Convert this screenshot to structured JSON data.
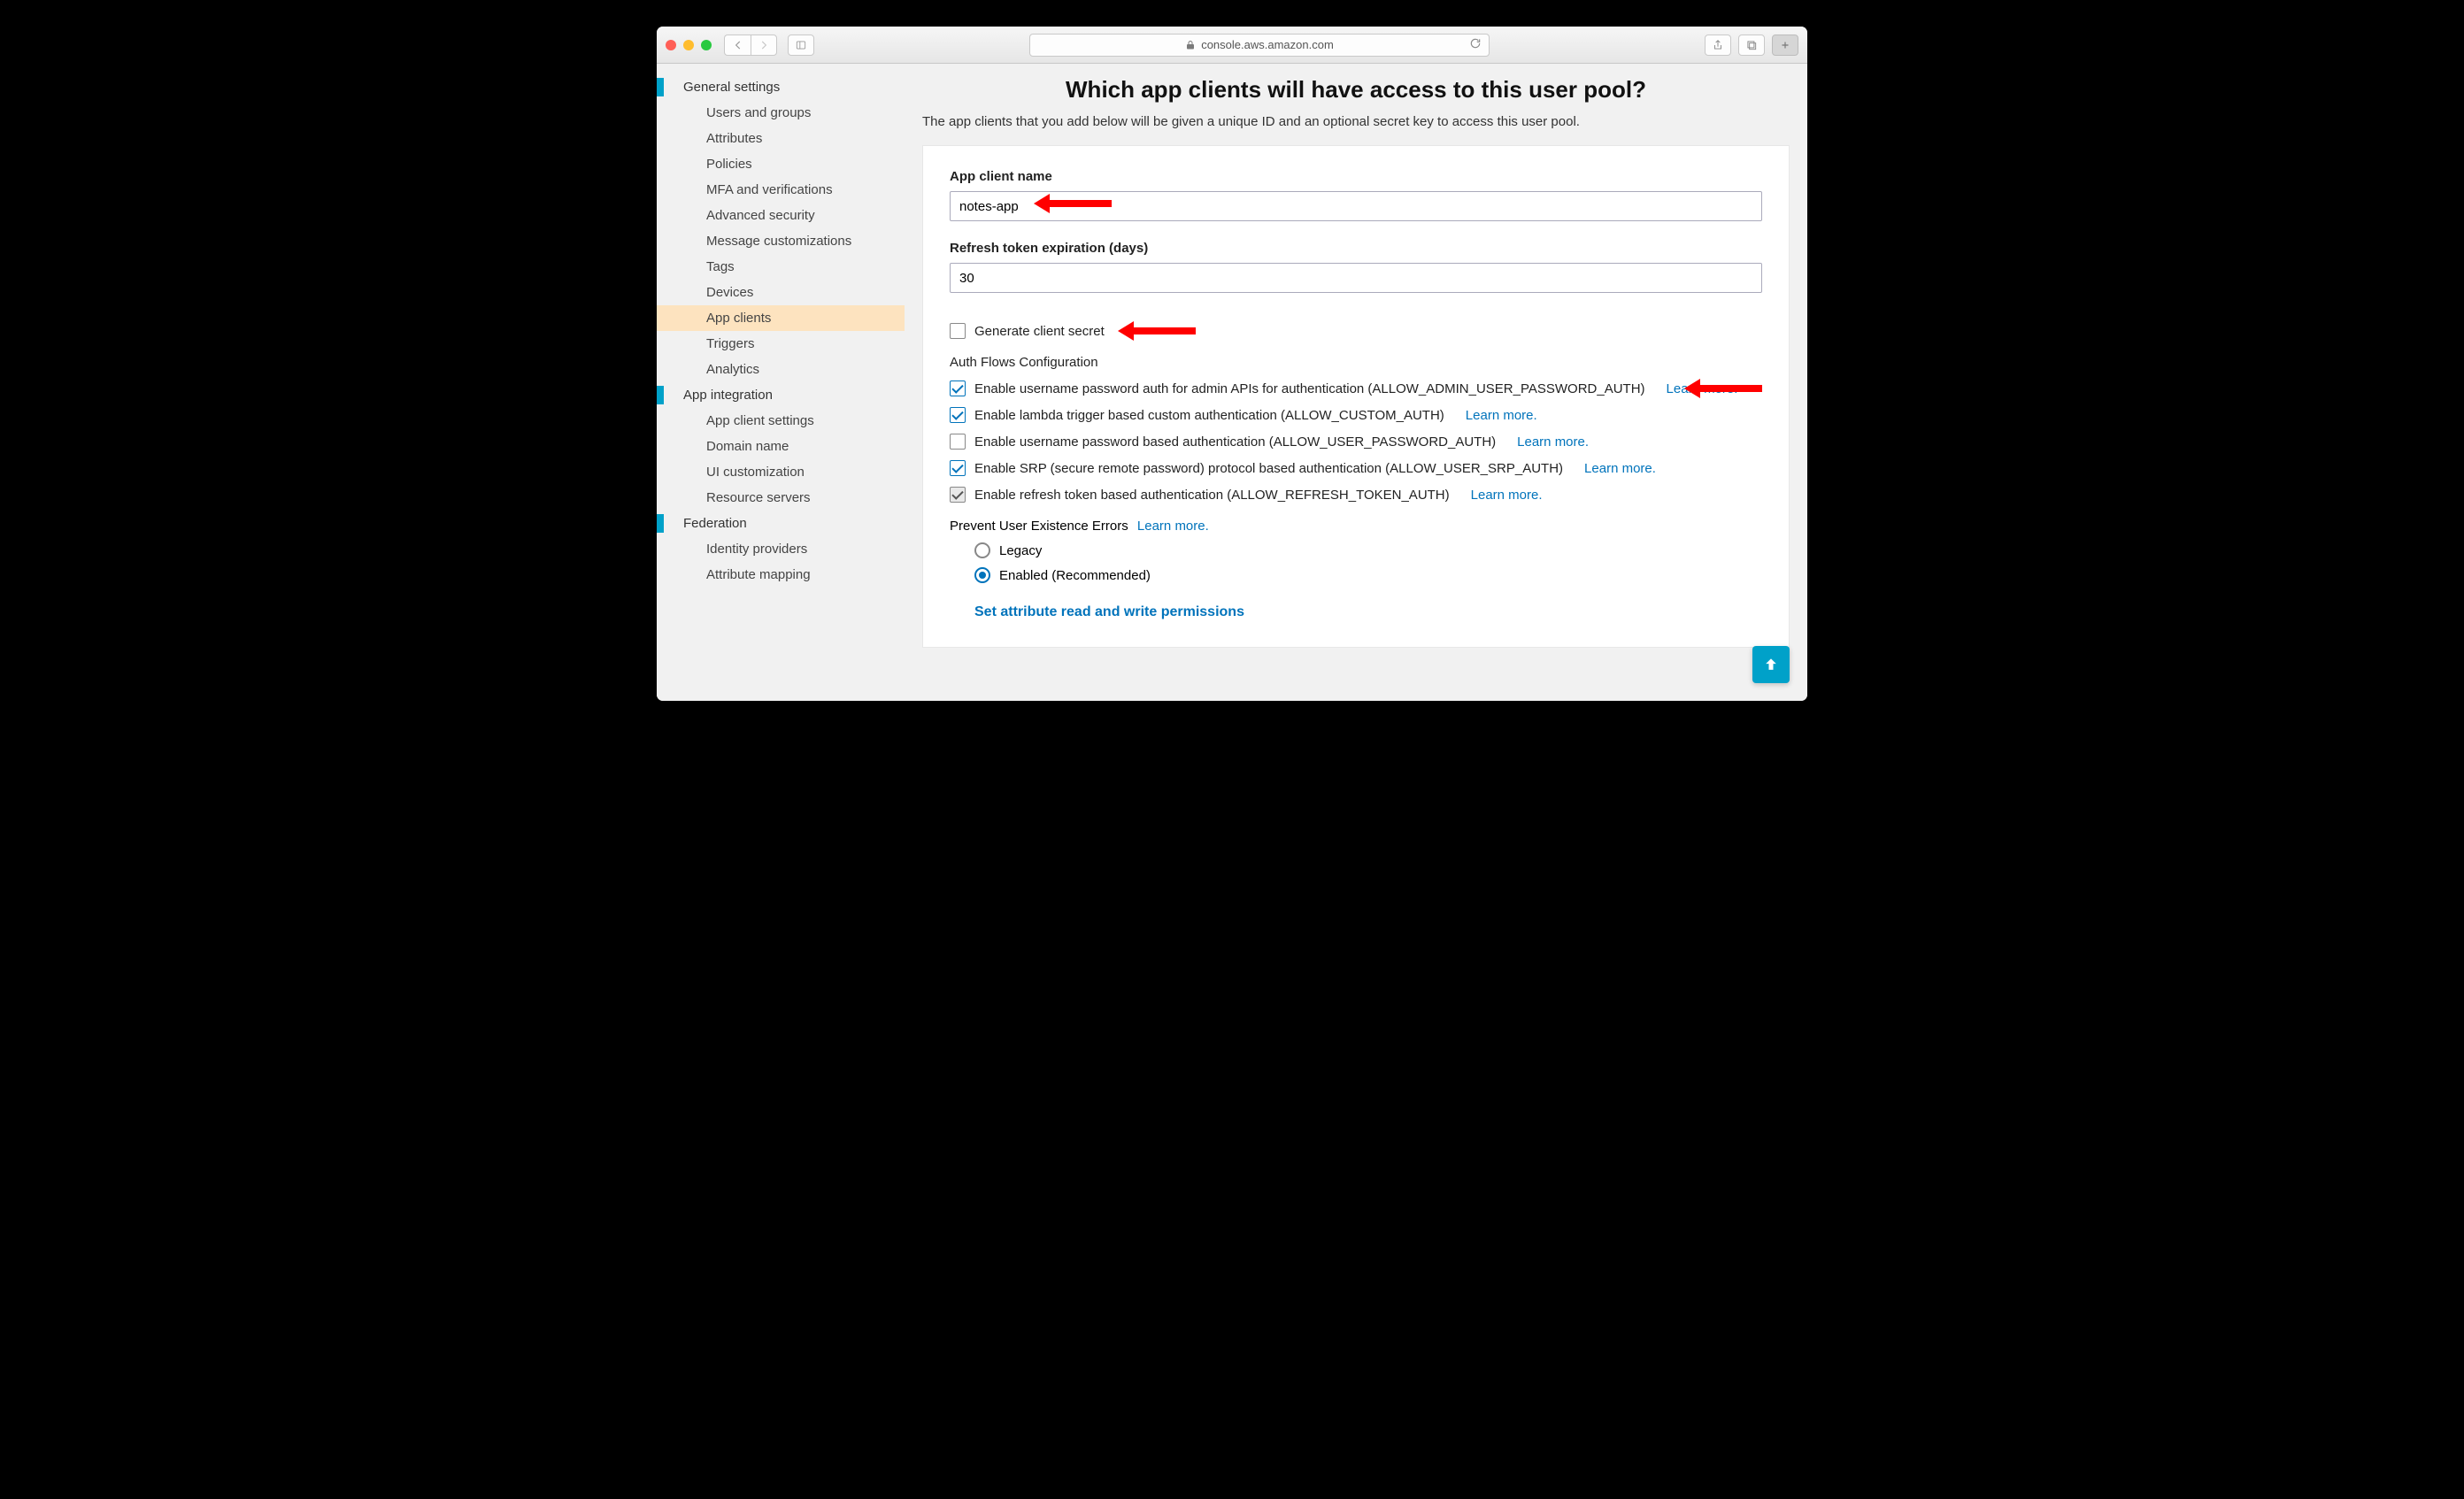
{
  "browser": {
    "url": "console.aws.amazon.com"
  },
  "sidebar": {
    "groups": [
      {
        "label": "General settings",
        "items": [
          "Users and groups",
          "Attributes",
          "Policies",
          "MFA and verifications",
          "Advanced security",
          "Message customizations",
          "Tags",
          "Devices",
          "App clients",
          "Triggers",
          "Analytics"
        ],
        "active": "App clients"
      },
      {
        "label": "App integration",
        "items": [
          "App client settings",
          "Domain name",
          "UI customization",
          "Resource servers"
        ]
      },
      {
        "label": "Federation",
        "items": [
          "Identity providers",
          "Attribute mapping"
        ]
      }
    ]
  },
  "main": {
    "title": "Which app clients will have access to this user pool?",
    "subtitle": "The app clients that you add below will be given a unique ID and an optional secret key to access this user pool.",
    "app_client_name_label": "App client name",
    "app_client_name_value": "notes-app",
    "refresh_label": "Refresh token expiration (days)",
    "refresh_value": "30",
    "generate_secret_label": "Generate client secret",
    "generate_secret_checked": false,
    "auth_flows_header": "Auth Flows Configuration",
    "auth_flows": [
      {
        "checked": true,
        "disabled": false,
        "label": "Enable username password auth for admin APIs for authentication (ALLOW_ADMIN_USER_PASSWORD_AUTH)",
        "learn": "Learn more."
      },
      {
        "checked": true,
        "disabled": false,
        "label": "Enable lambda trigger based custom authentication (ALLOW_CUSTOM_AUTH)",
        "learn": "Learn more."
      },
      {
        "checked": false,
        "disabled": false,
        "label": "Enable username password based authentication (ALLOW_USER_PASSWORD_AUTH)",
        "learn": "Learn more."
      },
      {
        "checked": true,
        "disabled": false,
        "label": "Enable SRP (secure remote password) protocol based authentication (ALLOW_USER_SRP_AUTH)",
        "learn": "Learn more."
      },
      {
        "checked": true,
        "disabled": true,
        "label": "Enable refresh token based authentication (ALLOW_REFRESH_TOKEN_AUTH)",
        "learn": "Learn more."
      }
    ],
    "prevent_header": "Prevent User Existence Errors",
    "prevent_learn": "Learn more.",
    "prevent_options": [
      {
        "label": "Legacy",
        "selected": false
      },
      {
        "label": "Enabled (Recommended)",
        "selected": true
      }
    ],
    "permissions_link": "Set attribute read and write permissions"
  }
}
